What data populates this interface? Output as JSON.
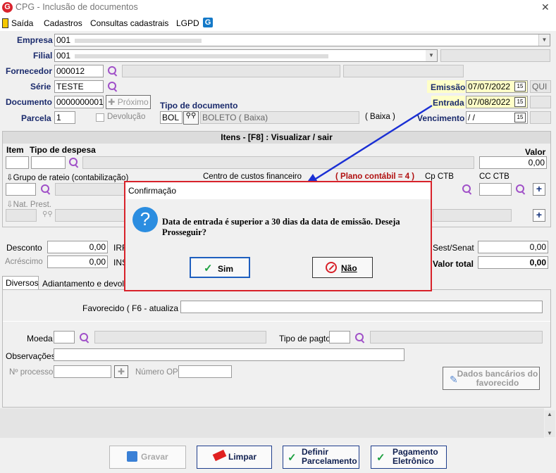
{
  "window": {
    "title": "CPG - Inclusão de documentos",
    "logo": "G",
    "close": "✕"
  },
  "menu": [
    "Saída",
    "Cadastros",
    "Consultas cadastrais",
    "LGPD"
  ],
  "header": {
    "empresa_label": "Empresa",
    "empresa_value": "001",
    "filial_label": "Filial",
    "filial_value": "001",
    "fornecedor_label": "Fornecedor",
    "fornecedor_value": "000012",
    "serie_label": "Série",
    "serie_value": "TESTE",
    "documento_label": "Documento",
    "documento_value": "0000000001",
    "proximo_label": "Próximo",
    "parcela_label": "Parcela",
    "parcela_value": "1",
    "devolucao_label": "Devolução",
    "tipo_doc_label": "Tipo de documento",
    "tipo_doc_code": "BOL",
    "tipo_doc_desc": "BOLETO ( Baixa)",
    "tipo_doc_note": "( Baixa )",
    "emissao_label": "Emissão",
    "emissao_value": "07/07/2022",
    "emissao_day": "QUI",
    "entrada_label": "Entrada",
    "entrada_value": "07/08/2022",
    "vencimento_label": "Vencimento",
    "vencimento_value": " / /",
    "cal_glyph": "15"
  },
  "itens": {
    "title": "Itens  - [F8] : Visualizar / sair",
    "item_label": "Item",
    "tipo_despesa_label": "Tipo de despesa",
    "valor_label": "Valor",
    "valor_value": "0,00",
    "grupo_label": "Grupo de rateio (contabilização)",
    "centro_label": "Centro de custos financeiro",
    "plano_label": "( Plano contábil = 4 )",
    "cpctb_label": "Cp CTB",
    "ccctb_label": "CC CTB",
    "natprest_label": "Nat. Prest."
  },
  "totals": {
    "desconto_label": "Desconto",
    "desconto_value": "0,00",
    "acrescimo_label": "Acréscimo",
    "acrescimo_value": "0,00",
    "irf_label": "IRF",
    "ins_label": "INS",
    "sest_label": "Sest/Senat",
    "sest_value": "0,00",
    "total_label": "Valor total",
    "total_value": "0,00"
  },
  "tabs": [
    "Diversos",
    "Adiantamento e devolução"
  ],
  "diversos": {
    "favorecido_label": "Favorecido ( F6 - atualiza )",
    "moeda_label": "Moeda",
    "tipo_pagto_label": "Tipo de pagto",
    "observacoes_label": "Observações",
    "nprocesso_label": "Nº processo",
    "numero_op_label": "Número OP",
    "dados_bancarios_label": "Dados bancários do favorecido"
  },
  "buttons": {
    "gravar": "Gravar",
    "limpar": "Limpar",
    "definir": "Definir Parcelamento",
    "pagamento": "Pagamento Eletrônico"
  },
  "dialog": {
    "title": "Confirmação",
    "message": "Data de entrada é superior a 30 dias da data de emissão. Deseja Prosseguir?",
    "yes": "Sim",
    "no": "Não",
    "icon": "?"
  },
  "colors": {
    "accent": "#d8222a",
    "highlight": "#ffffc8",
    "arrow": "#1a2fd4"
  }
}
